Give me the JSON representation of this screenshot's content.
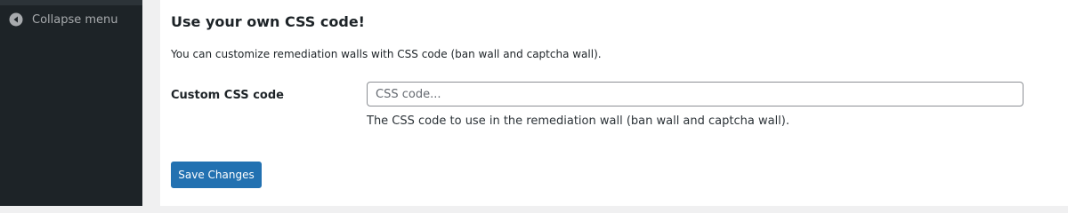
{
  "sidebar": {
    "collapse_label": "Collapse menu",
    "collapse_icon": "collapse-arrow-icon",
    "bg_color": "#1d2327"
  },
  "section": {
    "title": "Use your own CSS code!",
    "description": "You can customize remediation walls with CSS code (ban wall and captcha wall)."
  },
  "field": {
    "label": "Custom CSS code",
    "value": "",
    "placeholder": "CSS code...",
    "help": "The CSS code to use in the remediation wall (ban wall and captcha wall)."
  },
  "actions": {
    "save_label": "Save Changes",
    "primary_color": "#2271b1"
  }
}
